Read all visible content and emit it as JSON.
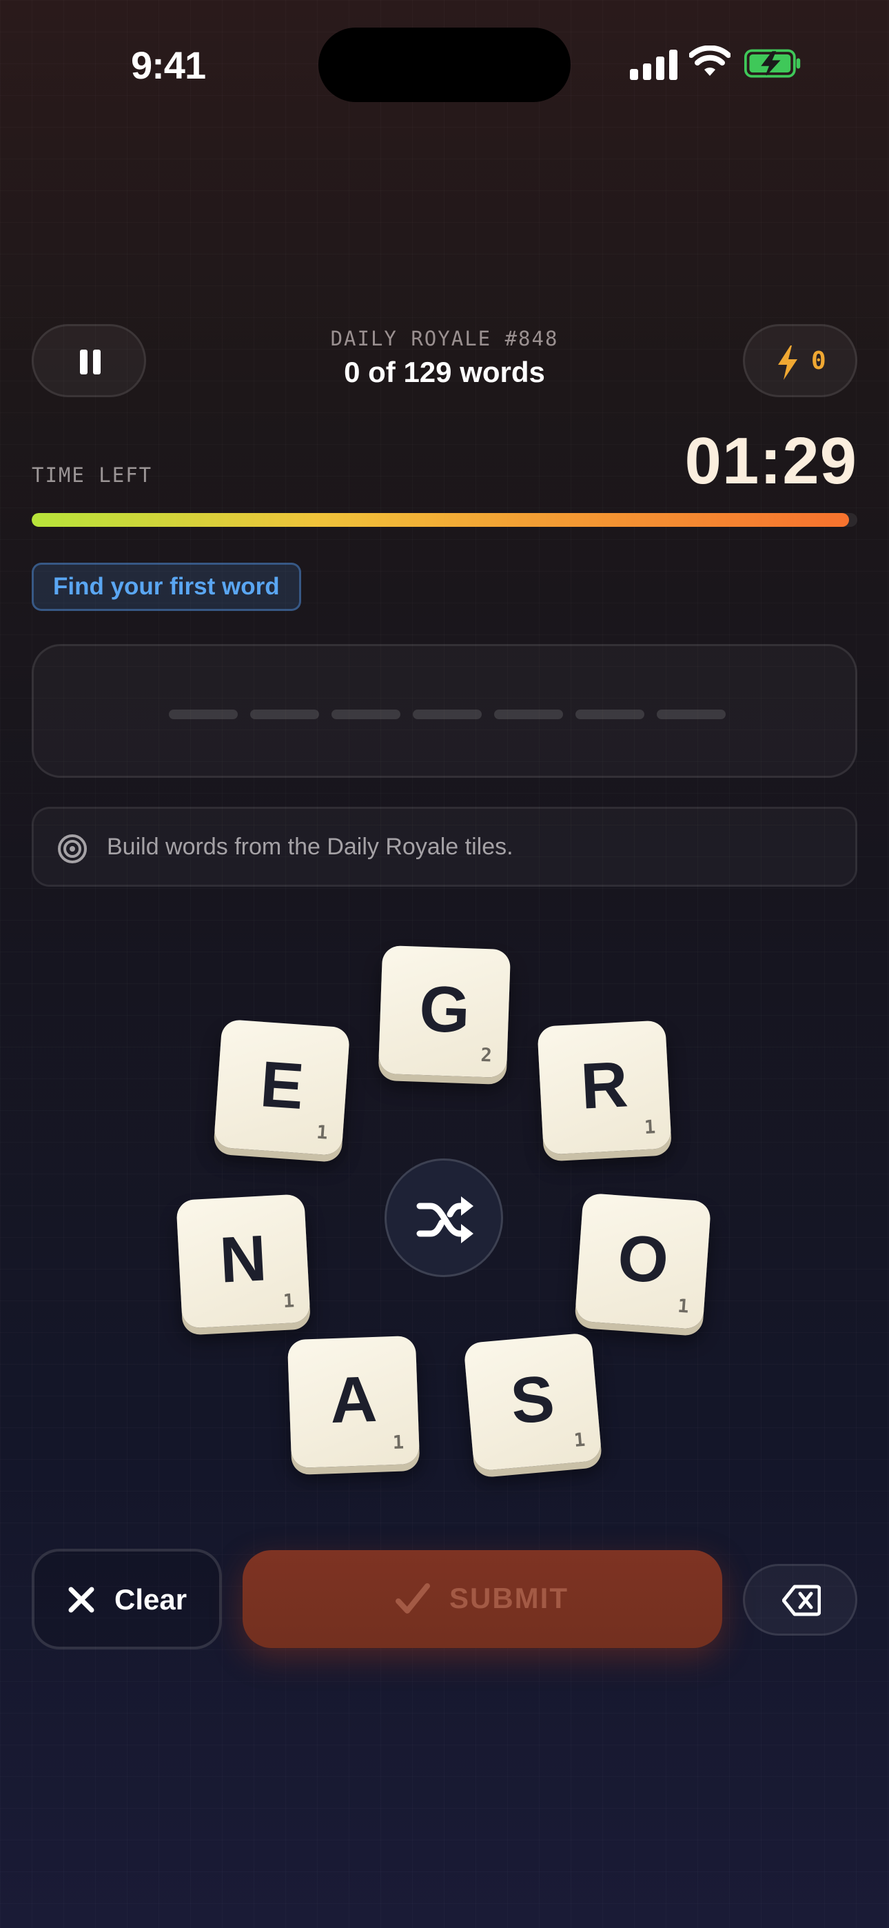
{
  "status_bar": {
    "time": "9:41"
  },
  "header": {
    "puzzle_id": "DAILY ROYALE #848",
    "progress": "0 of 129 words",
    "energy_count": "0"
  },
  "timer": {
    "label": "TIME LEFT",
    "value": "01:29",
    "progress_fraction": 0.99
  },
  "hint_badge": "Find your first word",
  "word_entry": {
    "slot_count": 7,
    "current_word": ""
  },
  "info": {
    "text": "Build words from the Daily Royale tiles."
  },
  "tiles": [
    {
      "letter": "G",
      "score": "2"
    },
    {
      "letter": "E",
      "score": "1"
    },
    {
      "letter": "R",
      "score": "1"
    },
    {
      "letter": "N",
      "score": "1"
    },
    {
      "letter": "O",
      "score": "1"
    },
    {
      "letter": "A",
      "score": "1"
    },
    {
      "letter": "S",
      "score": "1"
    }
  ],
  "controls": {
    "clear_label": "Clear",
    "submit_label": "SUBMIT"
  },
  "colors": {
    "accent_orange": "#f0a832",
    "hint_blue": "#5aa6f2",
    "timer_gradient_start": "#b7e43a",
    "timer_gradient_end": "#f6722e",
    "submit_bg": "#7e3323"
  },
  "icons": {
    "pause": "pause-icon",
    "energy": "lightning-bolt-icon",
    "info": "target-icon",
    "shuffle": "shuffle-icon",
    "clear": "close-icon",
    "submit": "checkmark-icon",
    "backspace": "backspace-icon"
  }
}
